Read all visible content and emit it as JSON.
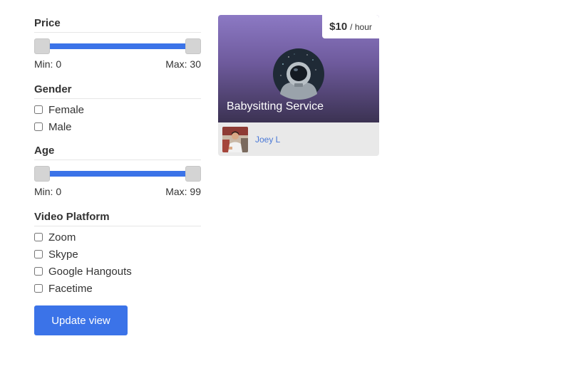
{
  "colors": {
    "accent": "#3b73e8",
    "track": "#3b73e8",
    "link": "#4a78d6",
    "card_footer_bg": "#e9e9e9"
  },
  "filters": {
    "price": {
      "title": "Price",
      "min_label": "Min: 0",
      "max_label": "Max: 30"
    },
    "gender": {
      "title": "Gender",
      "options": [
        "Female",
        "Male"
      ]
    },
    "age": {
      "title": "Age",
      "min_label": "Min: 0",
      "max_label": "Max: 99"
    },
    "video_platform": {
      "title": "Video Platform",
      "options": [
        "Zoom",
        "Skype",
        "Google Hangouts",
        "Facetime"
      ]
    },
    "update_button": "Update view"
  },
  "listing": {
    "price_amount": "$10",
    "price_unit": "/ hour",
    "title": "Babysitting Service",
    "icon": "astronaut-icon",
    "provider_name": "Joey L",
    "provider_avatar": "avatar-photo"
  }
}
